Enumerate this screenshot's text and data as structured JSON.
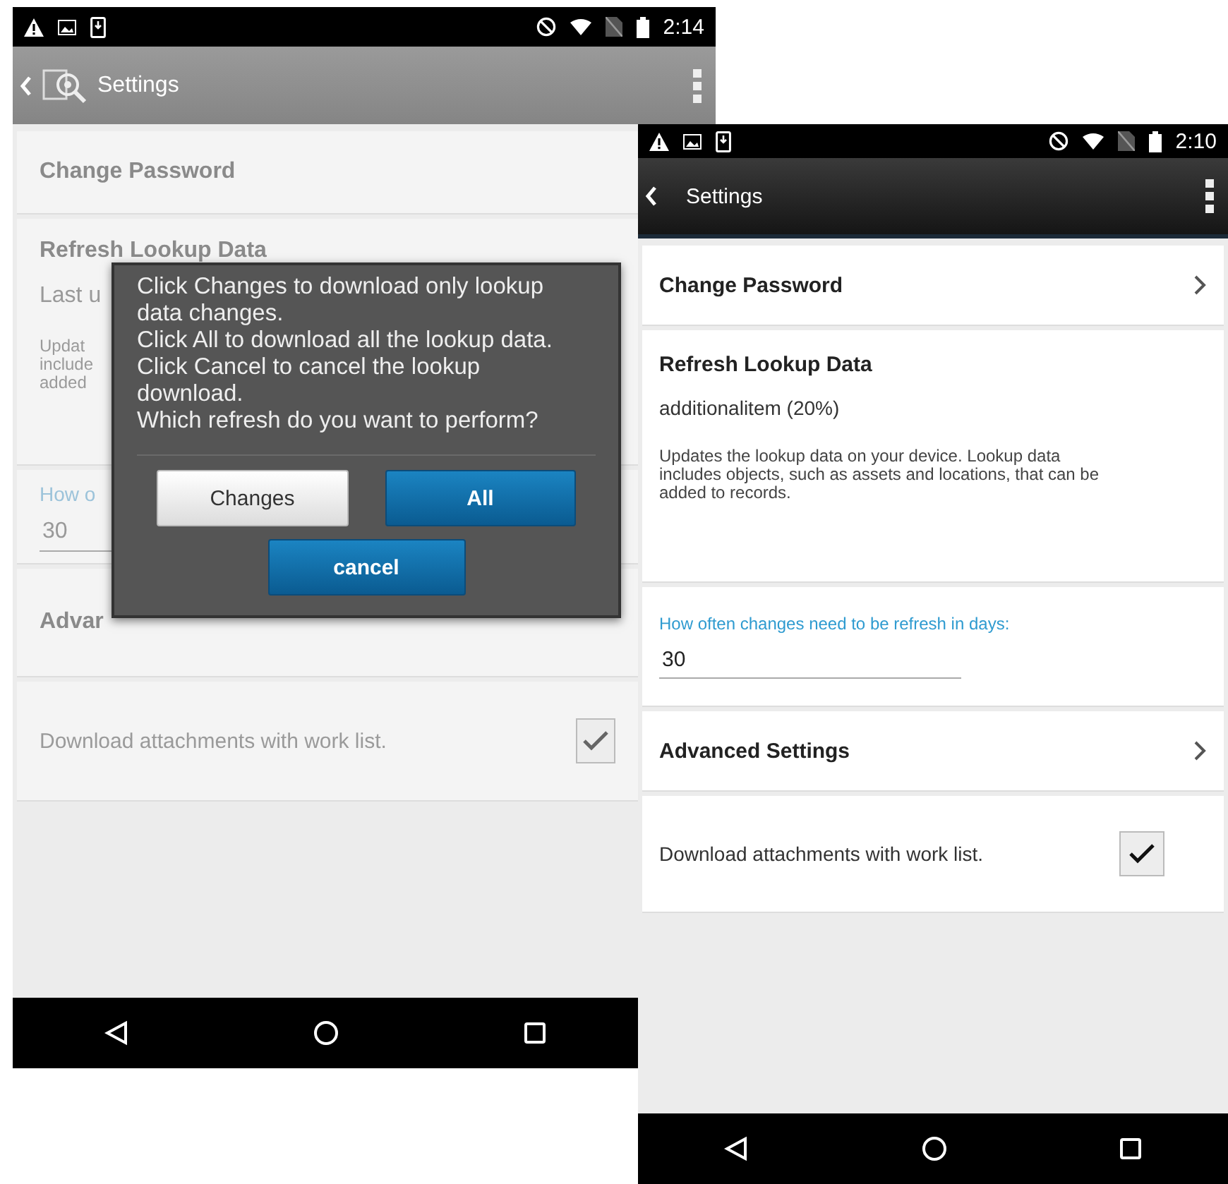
{
  "screens": [
    {
      "status_bar": {
        "time": "2:14"
      },
      "app_bar": {
        "title": "Settings",
        "logo": true
      },
      "dimmed": true,
      "items": [
        {
          "kind": "link",
          "title": "Change Password",
          "chevron": false
        },
        {
          "kind": "refresh",
          "title": "Refresh Lookup Data",
          "status": "Last u",
          "description": "Updat\ninclude\nadded"
        },
        {
          "kind": "field",
          "label": "How o",
          "value": "30"
        },
        {
          "kind": "link",
          "title": "Advar",
          "chevron": false
        },
        {
          "kind": "checkbox",
          "label": "Download attachments with work list.",
          "checked": true
        }
      ],
      "dialog": {
        "message": "Click Changes to download only lookup data changes.\nClick All to download all the lookup data.\nClick Cancel to cancel the lookup download.\nWhich refresh do you want to perform?",
        "buttons": [
          {
            "label": "Changes",
            "kind": "secondary"
          },
          {
            "label": "All",
            "kind": "primary"
          },
          {
            "label": "cancel",
            "kind": "primary"
          }
        ]
      }
    },
    {
      "status_bar": {
        "time": "2:10"
      },
      "app_bar": {
        "title": "Settings",
        "logo": false
      },
      "dimmed": false,
      "items": [
        {
          "kind": "link",
          "title": "Change Password",
          "chevron": true
        },
        {
          "kind": "refresh",
          "title": "Refresh Lookup Data",
          "status": "additionalitem (20%)",
          "description": "Updates the lookup data on your device. Lookup data\nincludes objects, such as assets and locations, that can be\nadded to records."
        },
        {
          "kind": "field",
          "label": "How often changes need to be refresh in days:",
          "value": "30"
        },
        {
          "kind": "link",
          "title": "Advanced Settings",
          "chevron": true
        },
        {
          "kind": "checkbox",
          "label": "Download attachments with work list.",
          "checked": true
        }
      ]
    }
  ]
}
